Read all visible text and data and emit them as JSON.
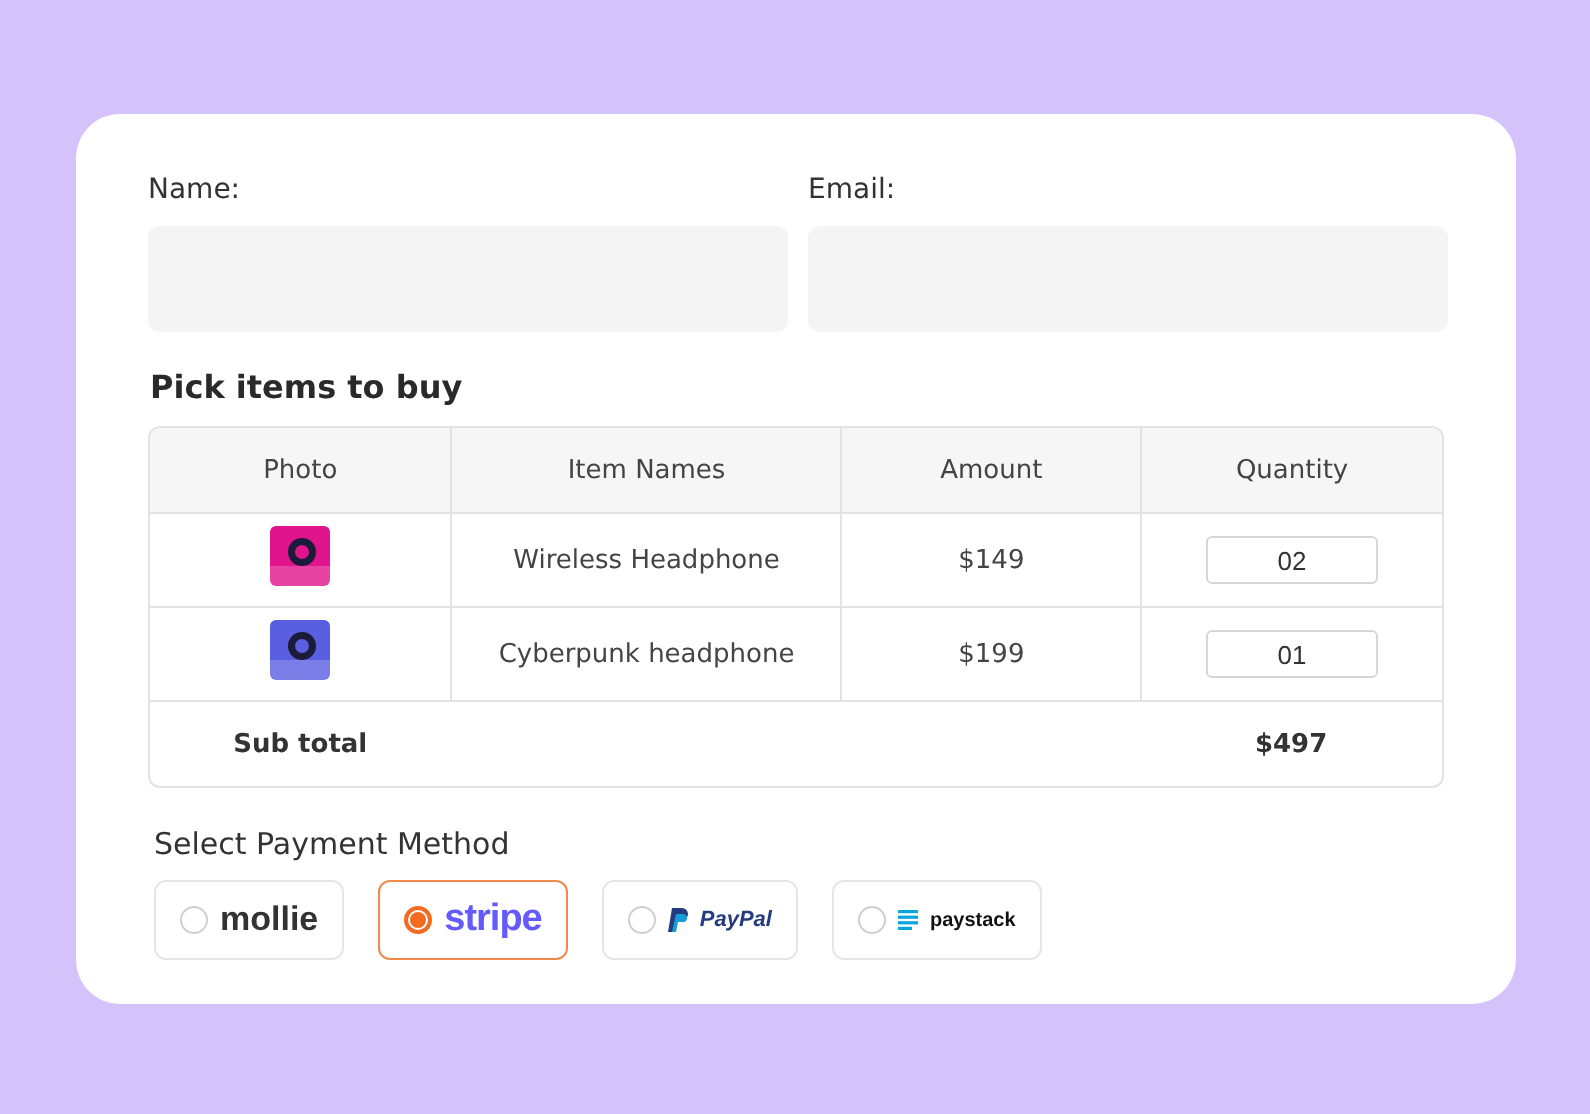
{
  "fields": [
    {
      "label": "Name:"
    },
    {
      "label": "Email:"
    }
  ],
  "heading": "Pick items to buy",
  "table": {
    "columns": [
      "Photo",
      "Item Names",
      "Amount",
      "Quantity"
    ],
    "rows": [
      {
        "name": "Wireless Headphone",
        "amount": "$149",
        "quantity": "02"
      },
      {
        "name": "Cyberpunk headphone",
        "amount": "$199",
        "quantity": "01"
      }
    ],
    "subtotal": {
      "label": "Sub total",
      "value": "$497"
    }
  },
  "payment": {
    "label": "Select Payment Method",
    "options": [
      {
        "kind": "mollie",
        "text": "mollie",
        "selected": false
      },
      {
        "kind": "stripe",
        "text": "stripe",
        "selected": true
      },
      {
        "kind": "paypal",
        "text": "PayPal",
        "selected": false
      },
      {
        "kind": "paystack",
        "text": "paystack",
        "selected": false
      }
    ]
  }
}
